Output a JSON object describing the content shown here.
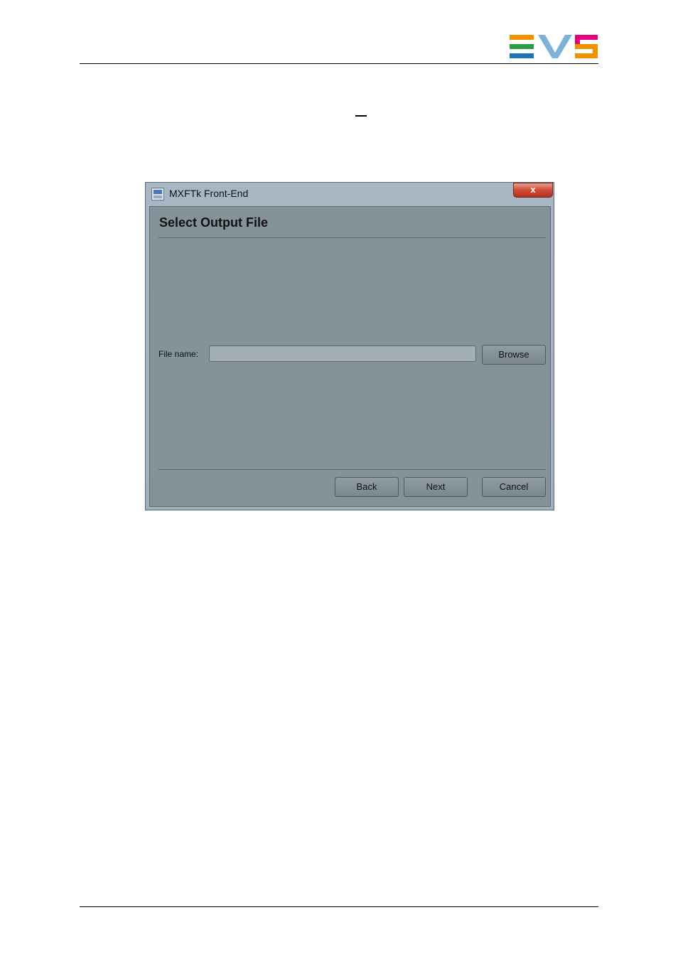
{
  "brand": {
    "logo_text": "EVS",
    "colors": {
      "e_stripes": [
        "#f39200",
        "#2a9d4a",
        "#1d71b8"
      ],
      "v": "#7fb2d9",
      "s_top": "#e5007e",
      "s_bottom": "#f39200"
    }
  },
  "window": {
    "title": "MXFTk Front-End",
    "close_label": "x",
    "page_title": "Select Output File",
    "file_name_label": "File name:",
    "file_name_value": "",
    "browse_label": "Browse",
    "back_label": "Back",
    "next_label": "Next",
    "cancel_label": "Cancel"
  }
}
